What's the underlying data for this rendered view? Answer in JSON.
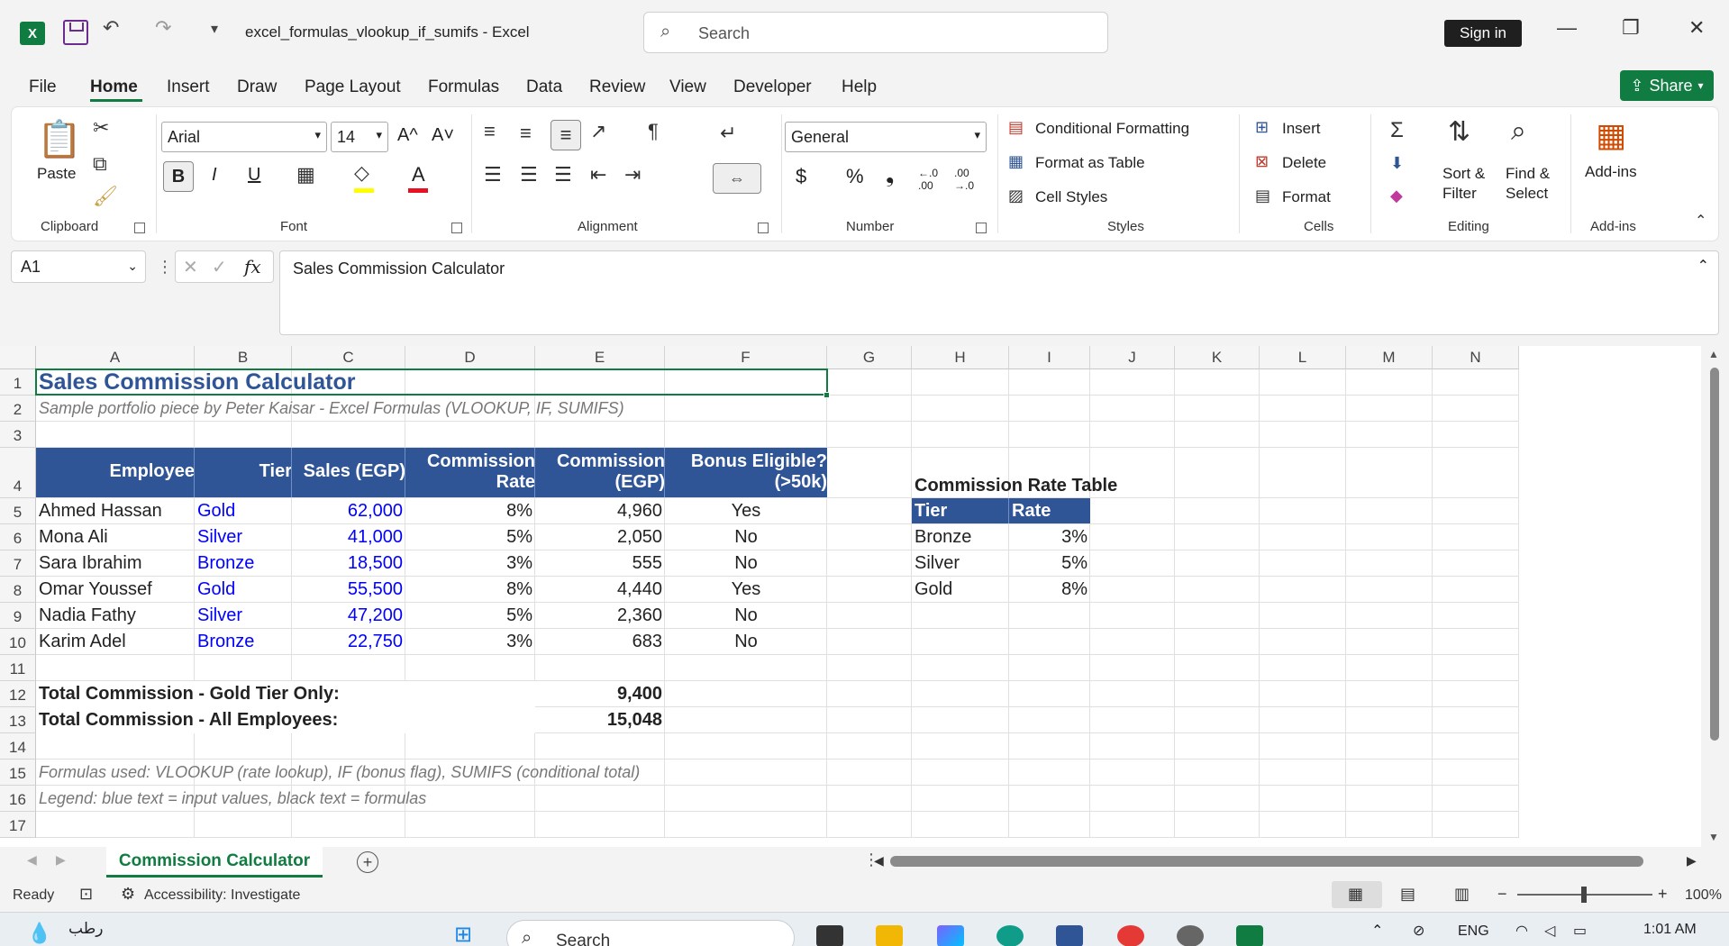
{
  "titlebar": {
    "app_letter": "X",
    "doc_title": "excel_formulas_vlookup_if_sumifs  -  Excel",
    "search_placeholder": "Search",
    "sign_in": "Sign in",
    "undo_glyph": "↶",
    "redo_glyph": "↷",
    "customize_glyph": "▾",
    "minimize_glyph": "—",
    "restore_glyph": "❐",
    "close_glyph": "✕"
  },
  "menu": {
    "tabs": [
      "File",
      "Home",
      "Insert",
      "Draw",
      "Page Layout",
      "Formulas",
      "Data",
      "Review",
      "View",
      "Developer",
      "Help"
    ],
    "share": "Share"
  },
  "ribbon": {
    "clipboard": {
      "label": "Clipboard",
      "paste": "Paste"
    },
    "font": {
      "label": "Font",
      "font_name": "Arial",
      "font_size": "14",
      "bold": "B",
      "italic": "I",
      "underline": "U",
      "grow": "A^",
      "shrink": "A˅",
      "font_color_letter": "A",
      "font_color": "#e81123",
      "fill_color": "#ffff00"
    },
    "alignment": {
      "label": "Alignment"
    },
    "number": {
      "label": "Number",
      "format": "General",
      "currency": "$",
      "percent": "%",
      "comma": "❟",
      "inc_decimal": "←.0 .00",
      "dec_decimal": ".00 →.0"
    },
    "styles": {
      "label": "Styles",
      "conditional": "Conditional Formatting",
      "format_table": "Format as Table",
      "cell_styles": "Cell Styles"
    },
    "cells": {
      "label": "Cells",
      "insert": "Insert",
      "delete": "Delete",
      "format": "Format"
    },
    "editing": {
      "label": "Editing",
      "sort_filter_1": "Sort &",
      "sort_filter_2": "Filter",
      "find_select_1": "Find &",
      "find_select_2": "Select"
    },
    "addins": {
      "label": "Add-ins",
      "addins": "Add-ins"
    }
  },
  "formula_bar": {
    "name_box": "A1",
    "fx": "fx",
    "content": "Sales Commission Calculator"
  },
  "columns": [
    "A",
    "B",
    "C",
    "D",
    "E",
    "F",
    "G",
    "H",
    "I",
    "J",
    "K",
    "L",
    "M",
    "N"
  ],
  "rows": [
    "1",
    "2",
    "3",
    "4",
    "5",
    "6",
    "7",
    "8",
    "9",
    "10",
    "11",
    "12",
    "13",
    "14",
    "15",
    "16",
    "17"
  ],
  "sheet": {
    "title": "Sales Commission Calculator",
    "subtitle": "Sample portfolio piece by Peter Kaisar - Excel Formulas (VLOOKUP, IF, SUMIFS)",
    "headers": {
      "employee": "Employee",
      "tier": "Tier",
      "sales": "Sales (EGP)",
      "rate_1": "Commission",
      "rate_2": "Rate",
      "comm_1": "Commission",
      "comm_2": "(EGP)",
      "bonus_1": "Bonus Eligible?",
      "bonus_2": "(>50k)"
    },
    "data": [
      {
        "employee": "Ahmed Hassan",
        "tier": "Gold",
        "sales": "62,000",
        "rate": "8%",
        "commission": "4,960",
        "bonus": "Yes"
      },
      {
        "employee": "Mona Ali",
        "tier": "Silver",
        "sales": "41,000",
        "rate": "5%",
        "commission": "2,050",
        "bonus": "No"
      },
      {
        "employee": "Sara Ibrahim",
        "tier": "Bronze",
        "sales": "18,500",
        "rate": "3%",
        "commission": "555",
        "bonus": "No"
      },
      {
        "employee": "Omar Youssef",
        "tier": "Gold",
        "sales": "55,500",
        "rate": "8%",
        "commission": "4,440",
        "bonus": "Yes"
      },
      {
        "employee": "Nadia Fathy",
        "tier": "Silver",
        "sales": "47,200",
        "rate": "5%",
        "commission": "2,360",
        "bonus": "No"
      },
      {
        "employee": "Karim Adel",
        "tier": "Bronze",
        "sales": "22,750",
        "rate": "3%",
        "commission": "683",
        "bonus": "No"
      }
    ],
    "totals": {
      "gold_label": "Total Commission - Gold Tier Only:",
      "gold_value": "9,400",
      "all_label": "Total Commission - All Employees:",
      "all_value": "15,048"
    },
    "notes": {
      "formulas": "Formulas used: VLOOKUP (rate lookup), IF (bonus flag), SUMIFS (conditional total)",
      "legend": "Legend: blue text = input values, black text = formulas"
    },
    "rate_table": {
      "title": "Commission Rate Table",
      "header_tier": "Tier",
      "header_rate": "Rate",
      "rows": [
        {
          "tier": "Bronze",
          "rate": "3%"
        },
        {
          "tier": "Silver",
          "rate": "5%"
        },
        {
          "tier": "Gold",
          "rate": "8%"
        }
      ]
    }
  },
  "sheet_tabs": {
    "active": "Commission Calculator",
    "add": "+"
  },
  "status": {
    "ready": "Ready",
    "accessibility": "Accessibility: Investigate",
    "zoom": "100%",
    "zoom_minus": "−",
    "zoom_plus": "+"
  },
  "taskbar": {
    "weather": "رطب",
    "search": "Search",
    "lang": "ENG",
    "time": "1:01 AM"
  },
  "colors": {
    "accent": "#107c41",
    "header_fill": "#2f5597",
    "input_blue": "#0000ff",
    "title_blue": "#2f5597"
  }
}
